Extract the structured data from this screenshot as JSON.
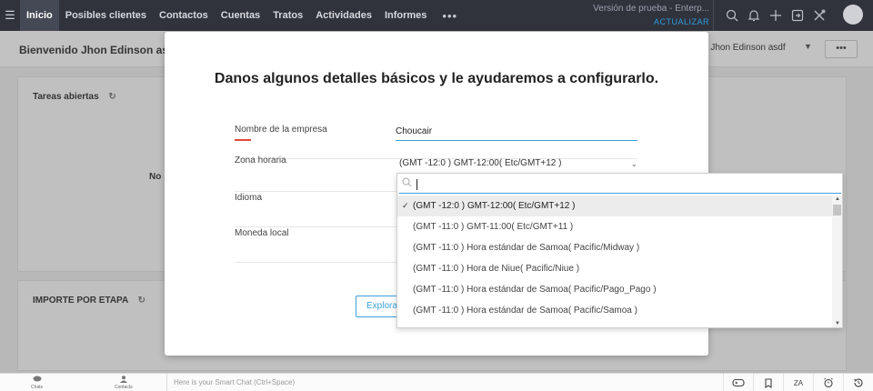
{
  "nav": {
    "menu_icon": "hamburger-icon",
    "tabs": [
      "Inicio",
      "Posibles clientes",
      "Contactos",
      "Cuentas",
      "Tratos",
      "Actividades",
      "Informes"
    ],
    "more": "•••",
    "trial_text": "Versión de prueba - Enterp...",
    "upgrade": "ACTUALIZAR",
    "icons": [
      "search-icon",
      "bell-icon",
      "plus-icon",
      "export-icon",
      "tools-icon",
      "avatar"
    ]
  },
  "subheader": {
    "welcome": "Bienvenido Jhon Edinson asd",
    "user": "e Jhon Edinson asdf",
    "more": "•••"
  },
  "cards": {
    "tasks_title": "Tareas abiertas",
    "no_data": "No",
    "pipeline_title": "IMPORTE POR ETAPA"
  },
  "modal": {
    "title": "Danos algunos detalles básicos y le ayudaremos a configurarlo.",
    "company_label": "Nombre de la empresa",
    "company_value": "Choucair",
    "timezone_label": "Zona horaria",
    "timezone_value": "(GMT -12:0 ) GMT-12:00( Etc/GMT+12 )",
    "language_label": "Idioma",
    "currency_label": "Moneda local",
    "explore_button": "Explorar"
  },
  "dropdown": {
    "search_value": "",
    "options": [
      "(GMT -12:0 ) GMT-12:00( Etc/GMT+12 )",
      "(GMT -11:0 ) GMT-11:00( Etc/GMT+11 )",
      "(GMT -11:0 ) Hora estándar de Samoa( Pacific/Midway )",
      "(GMT -11:0 ) Hora de Niue( Pacific/Niue )",
      "(GMT -11:0 ) Hora estándar de Samoa( Pacific/Pago_Pago )",
      "(GMT -11:0 ) Hora estándar de Samoa( Pacific/Samoa )"
    ],
    "selected_index": 0
  },
  "bottombar": {
    "chats": "Chats",
    "contacts": "Contacts",
    "smart_chat_placeholder": "Here is your Smart Chat (Ctrl+Space)",
    "icons": [
      "gamepad-icon",
      "tag-icon",
      "translate-icon",
      "alarm-icon",
      "history-icon"
    ],
    "translate_glyph": "ZA"
  },
  "colors": {
    "nav_bg": "#30333c",
    "accent": "#3aa1d9",
    "required": "#e0483b"
  }
}
